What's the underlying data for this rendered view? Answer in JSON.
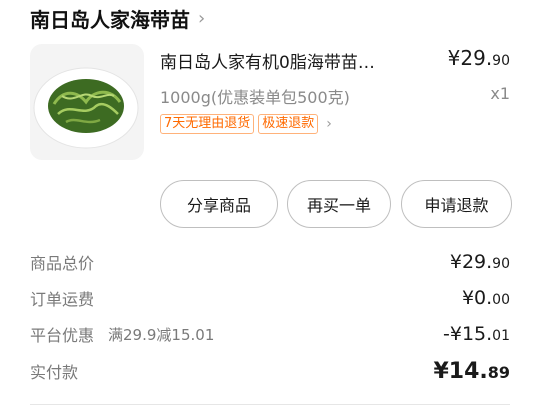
{
  "store": {
    "name": "南日岛人家海带苗",
    "chevron": "›"
  },
  "product": {
    "image_icon": "seaweed-dish-photo",
    "title": "南日岛人家有机0脂海带苗…",
    "price_main": "¥29.",
    "price_decimal": "90",
    "spec": "1000g(优惠装单包500克)",
    "qty": "x1",
    "tags": [
      "7天无理由退货",
      "极速退款"
    ],
    "tag_chevron": "›"
  },
  "actions": {
    "share": "分享商品",
    "rebuy": "再买一单",
    "refund": "申请退款"
  },
  "summary": {
    "total_label": "商品总价",
    "total_main": "¥29.",
    "total_dec": "90",
    "shipping_label": "订单运费",
    "shipping_main": "¥0.",
    "shipping_dec": "00",
    "discount_label": "平台优惠",
    "discount_note": "满29.9减15.01",
    "discount_main": "-¥15.",
    "discount_dec": "01",
    "paid_label": "实付款",
    "paid_main": "¥14.",
    "paid_dec": "89"
  }
}
